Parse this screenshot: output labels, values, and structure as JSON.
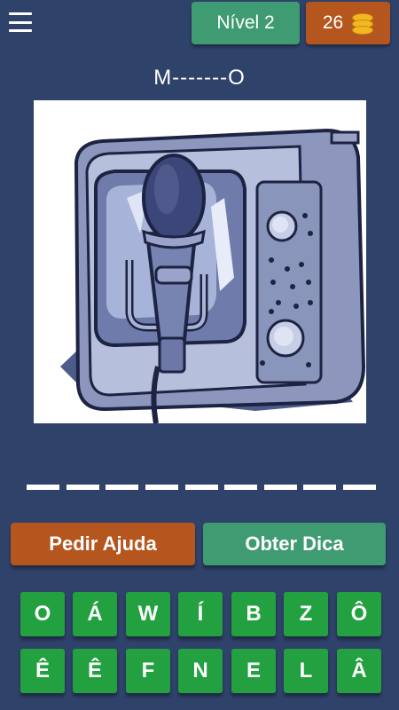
{
  "header": {
    "menu_icon": "hamburger-icon",
    "level_label": "Nível 2",
    "coins": "26",
    "coin_icon": "coin-stack-icon"
  },
  "puzzle": {
    "word_hint": "M-------O",
    "picture": "retro microphone and radio illustration",
    "answer_slots": 9
  },
  "actions": {
    "help_label": "Pedir Ajuda",
    "tip_label": "Obter Dica"
  },
  "keyboard": {
    "row1": [
      "O",
      "Á",
      "W",
      "Í",
      "B",
      "Z",
      "Ô"
    ],
    "row2": [
      "Ê",
      "Ê",
      "F",
      "N",
      "E",
      "L",
      "Â"
    ]
  },
  "colors": {
    "background": "#2f426a",
    "green": "#3f9b72",
    "orange": "#b5561f",
    "key_green": "#23a03f"
  }
}
